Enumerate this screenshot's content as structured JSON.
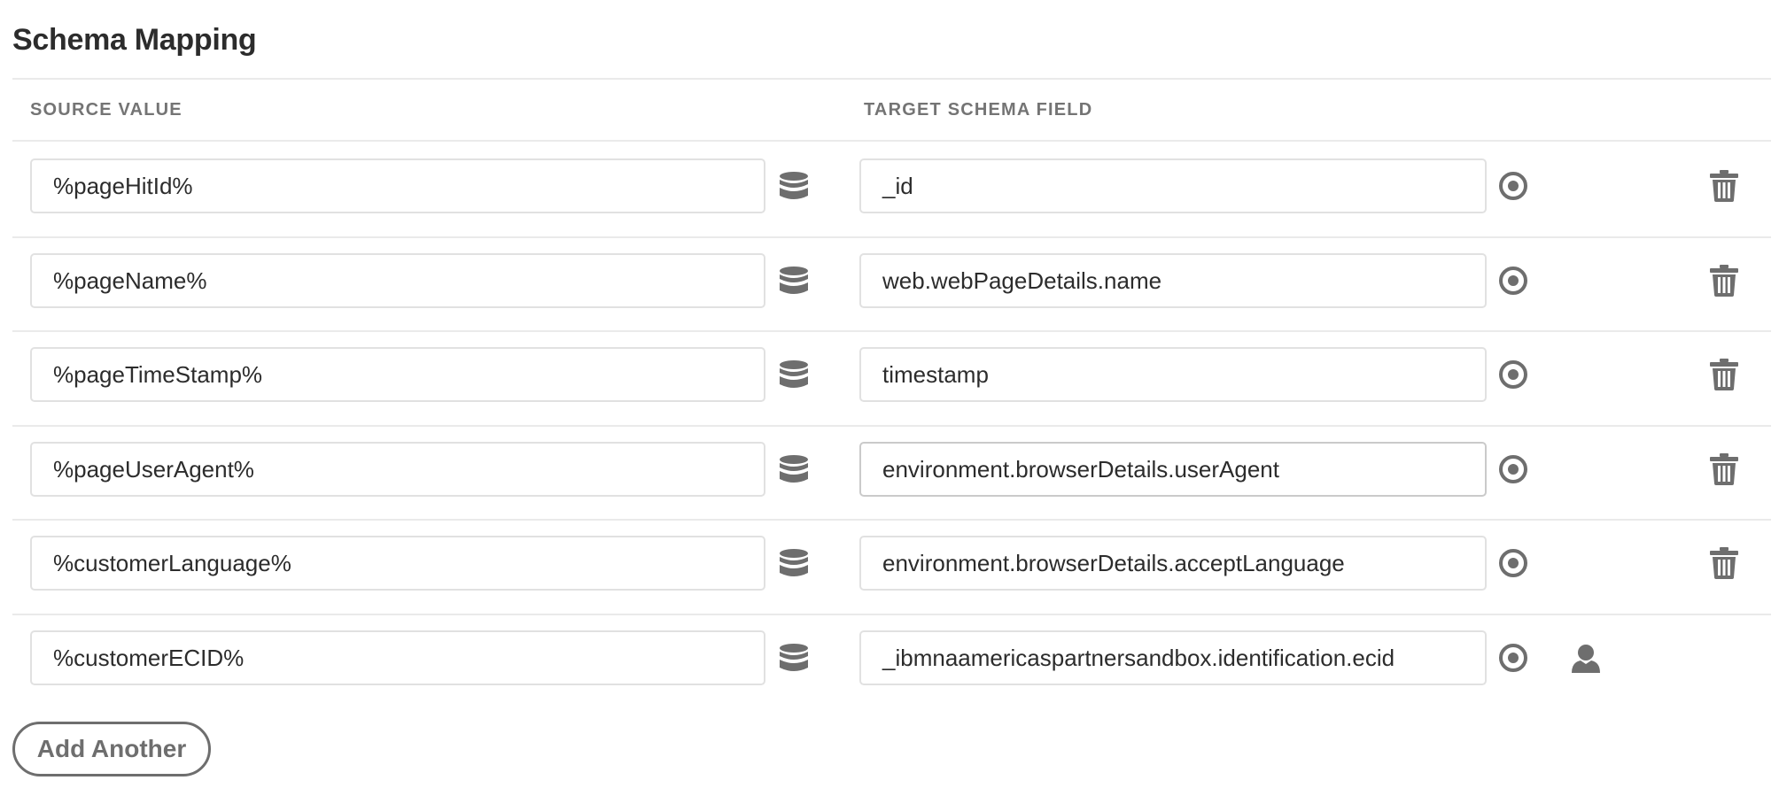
{
  "section": {
    "title": "Schema Mapping"
  },
  "columns": {
    "source": "SOURCE VALUE",
    "target": "TARGET SCHEMA FIELD"
  },
  "rows": [
    {
      "source": "%pageHitId%",
      "target": "_id",
      "deletable": true,
      "identity": false
    },
    {
      "source": "%pageName%",
      "target": "web.webPageDetails.name",
      "deletable": true,
      "identity": false
    },
    {
      "source": "%pageTimeStamp%",
      "target": "timestamp",
      "deletable": true,
      "identity": false
    },
    {
      "source": "%pageUserAgent%",
      "target": "environment.browserDetails.userAgent",
      "deletable": true,
      "identity": false
    },
    {
      "source": "%customerLanguage%",
      "target": "environment.browserDetails.acceptLanguage",
      "deletable": true,
      "identity": false
    },
    {
      "source": "%customerECID%",
      "target": "_ibmnaamericaspartnersandbox.identification.ecid",
      "deletable": false,
      "identity": true
    }
  ],
  "actions": {
    "add_label": "Add Another"
  },
  "icons": {
    "source_picker": "database-icon",
    "target_picker": "target-icon",
    "delete": "trash-icon",
    "identity": "user-icon"
  },
  "colors": {
    "icon": "#6e6e6e",
    "field_border": "#e1e1e1",
    "text": "#2c2c2c",
    "header_text": "#747474"
  }
}
